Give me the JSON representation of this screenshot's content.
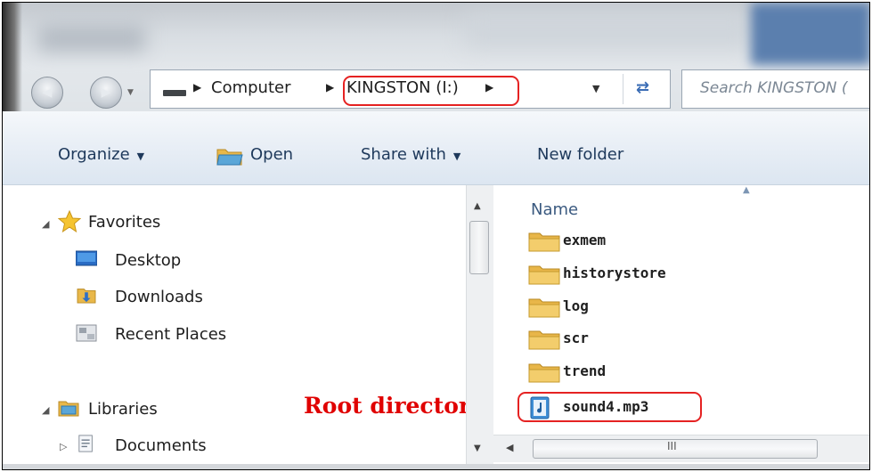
{
  "nav": {
    "back_icon": "back-arrow-icon",
    "forward_icon": "forward-arrow-icon",
    "history_icon": "chevron-down-icon"
  },
  "address": {
    "crumbs": [
      "Computer",
      "KINGSTON (I:)"
    ],
    "highlighted_crumb": "KINGSTON (I:)",
    "highlight_color": "#e52222"
  },
  "search": {
    "placeholder": "Search KINGSTON ("
  },
  "toolbar": {
    "organize": "Organize",
    "open": "Open",
    "share_with": "Share with",
    "new_folder": "New folder"
  },
  "sidebar": {
    "favorites": {
      "label": "Favorites",
      "items": [
        {
          "label": "Desktop",
          "icon": "desktop-icon"
        },
        {
          "label": "Downloads",
          "icon": "downloads-icon"
        },
        {
          "label": "Recent Places",
          "icon": "recent-places-icon"
        }
      ]
    },
    "libraries": {
      "label": "Libraries",
      "items": [
        {
          "label": "Documents",
          "icon": "documents-icon"
        }
      ]
    }
  },
  "files": {
    "column_name": "Name",
    "items": [
      {
        "name": "exmem",
        "type": "folder"
      },
      {
        "name": "historystore",
        "type": "folder"
      },
      {
        "name": "log",
        "type": "folder"
      },
      {
        "name": "scr",
        "type": "folder"
      },
      {
        "name": "trend",
        "type": "folder"
      },
      {
        "name": "sound4.mp3",
        "type": "audio"
      }
    ]
  },
  "annotation": {
    "text": "Root directory",
    "color": "#e00000"
  },
  "scrollbar": {
    "grip": "III"
  }
}
